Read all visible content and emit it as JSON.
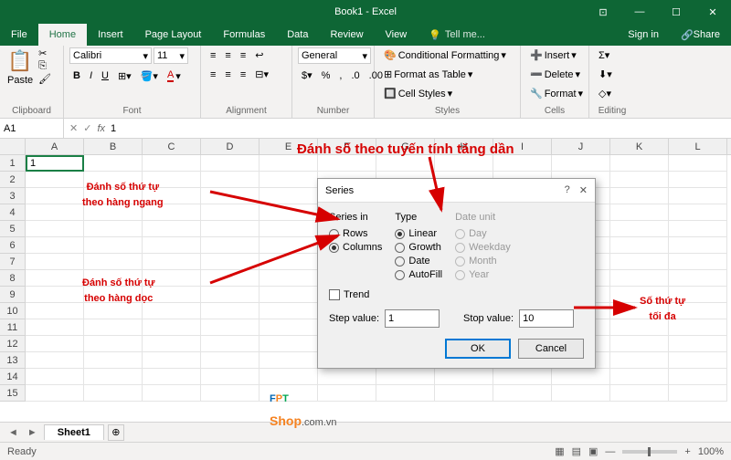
{
  "title": "Book1 - Excel",
  "menu": {
    "file": "File",
    "home": "Home",
    "insert": "Insert",
    "pagelayout": "Page Layout",
    "formulas": "Formulas",
    "data": "Data",
    "review": "Review",
    "view": "View",
    "tellme": "Tell me...",
    "signin": "Sign in",
    "share": "Share"
  },
  "ribbon": {
    "clipboard": {
      "label": "Clipboard",
      "paste": "Paste"
    },
    "font": {
      "label": "Font",
      "name": "Calibri",
      "size": "11"
    },
    "alignment": {
      "label": "Alignment"
    },
    "number": {
      "label": "Number",
      "format": "General"
    },
    "styles": {
      "label": "Styles",
      "cond": "Conditional Formatting",
      "table": "Format as Table",
      "cell": "Cell Styles"
    },
    "cells": {
      "label": "Cells",
      "insert": "Insert",
      "delete": "Delete",
      "format": "Format"
    },
    "editing": {
      "label": "Editing"
    }
  },
  "namebox": "A1",
  "formula": "1",
  "cols": [
    "A",
    "B",
    "C",
    "D",
    "E",
    "F",
    "G",
    "H",
    "I",
    "J",
    "K",
    "L"
  ],
  "rowcount": 15,
  "cellA1": "1",
  "sheet": "Sheet1",
  "status": "Ready",
  "zoom": "100%",
  "dialog": {
    "title": "Series",
    "seriesin": "Series in",
    "rows": "Rows",
    "columns": "Columns",
    "type": "Type",
    "linear": "Linear",
    "growth": "Growth",
    "date": "Date",
    "autofill": "AutoFill",
    "dateunit": "Date unit",
    "day": "Day",
    "weekday": "Weekday",
    "month": "Month",
    "year": "Year",
    "trend": "Trend",
    "step": "Step value:",
    "stepv": "1",
    "stop": "Stop value:",
    "stopv": "10",
    "ok": "OK",
    "cancel": "Cancel"
  },
  "anno": {
    "a1": "Đánh số theo tuyến tính tăng dần",
    "a2a": "Đánh số thứ tự",
    "a2b": "theo hàng ngang",
    "a3a": "Đánh số thứ tự",
    "a3b": "theo hàng dọc",
    "a4a": "Số thứ tự",
    "a4b": "tối đa"
  }
}
